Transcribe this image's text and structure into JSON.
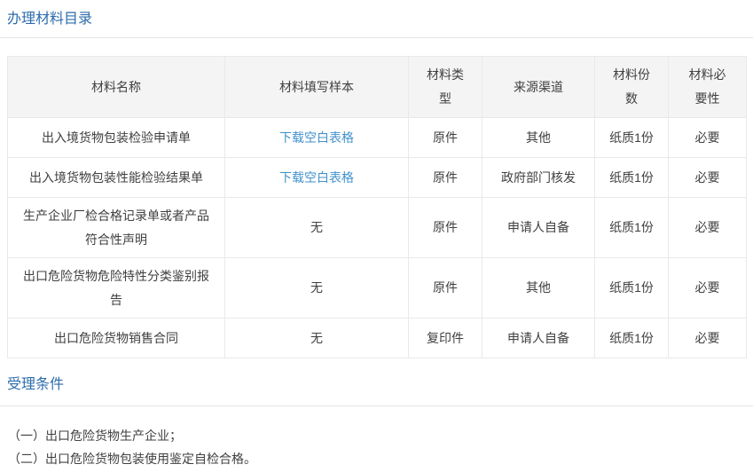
{
  "page": {
    "section1_title": "办理材料目录",
    "section2_title": "受理条件"
  },
  "colors": {
    "title_blue": "#2d6cab",
    "link_blue": "#4292cd",
    "header_bg": "#f4f4f4",
    "border": "#e9e9e9",
    "text": "#404040"
  },
  "table": {
    "headers": [
      "材料名称",
      "材料填写样本",
      "材料类型",
      "来源渠道",
      "材料份数",
      "材料必要性"
    ],
    "rows": [
      {
        "name": "出入境货物包装检验申请单",
        "sample": "下载空白表格",
        "type": "原件",
        "source": "其他",
        "copies": "纸质1份",
        "required": "必要"
      },
      {
        "name": "出入境货物包装性能检验结果单",
        "sample": "下载空白表格",
        "type": "原件",
        "source": "政府部门核发",
        "copies": "纸质1份",
        "required": "必要"
      },
      {
        "name": "生产企业厂检合格记录单或者产品符合性声明",
        "sample": "无",
        "type": "原件",
        "source": "申请人自备",
        "copies": "纸质1份",
        "required": "必要"
      },
      {
        "name": "出口危险货物危险特性分类鉴别报告",
        "sample": "无",
        "type": "原件",
        "source": "其他",
        "copies": "纸质1份",
        "required": "必要"
      },
      {
        "name": "出口危险货物销售合同",
        "sample": "无",
        "type": "复印件",
        "source": "申请人自备",
        "copies": "纸质1份",
        "required": "必要"
      }
    ]
  },
  "conditions": [
    "（一）出口危险货物生产企业；",
    "（二）出口危险货物包装使用鉴定自检合格。"
  ]
}
